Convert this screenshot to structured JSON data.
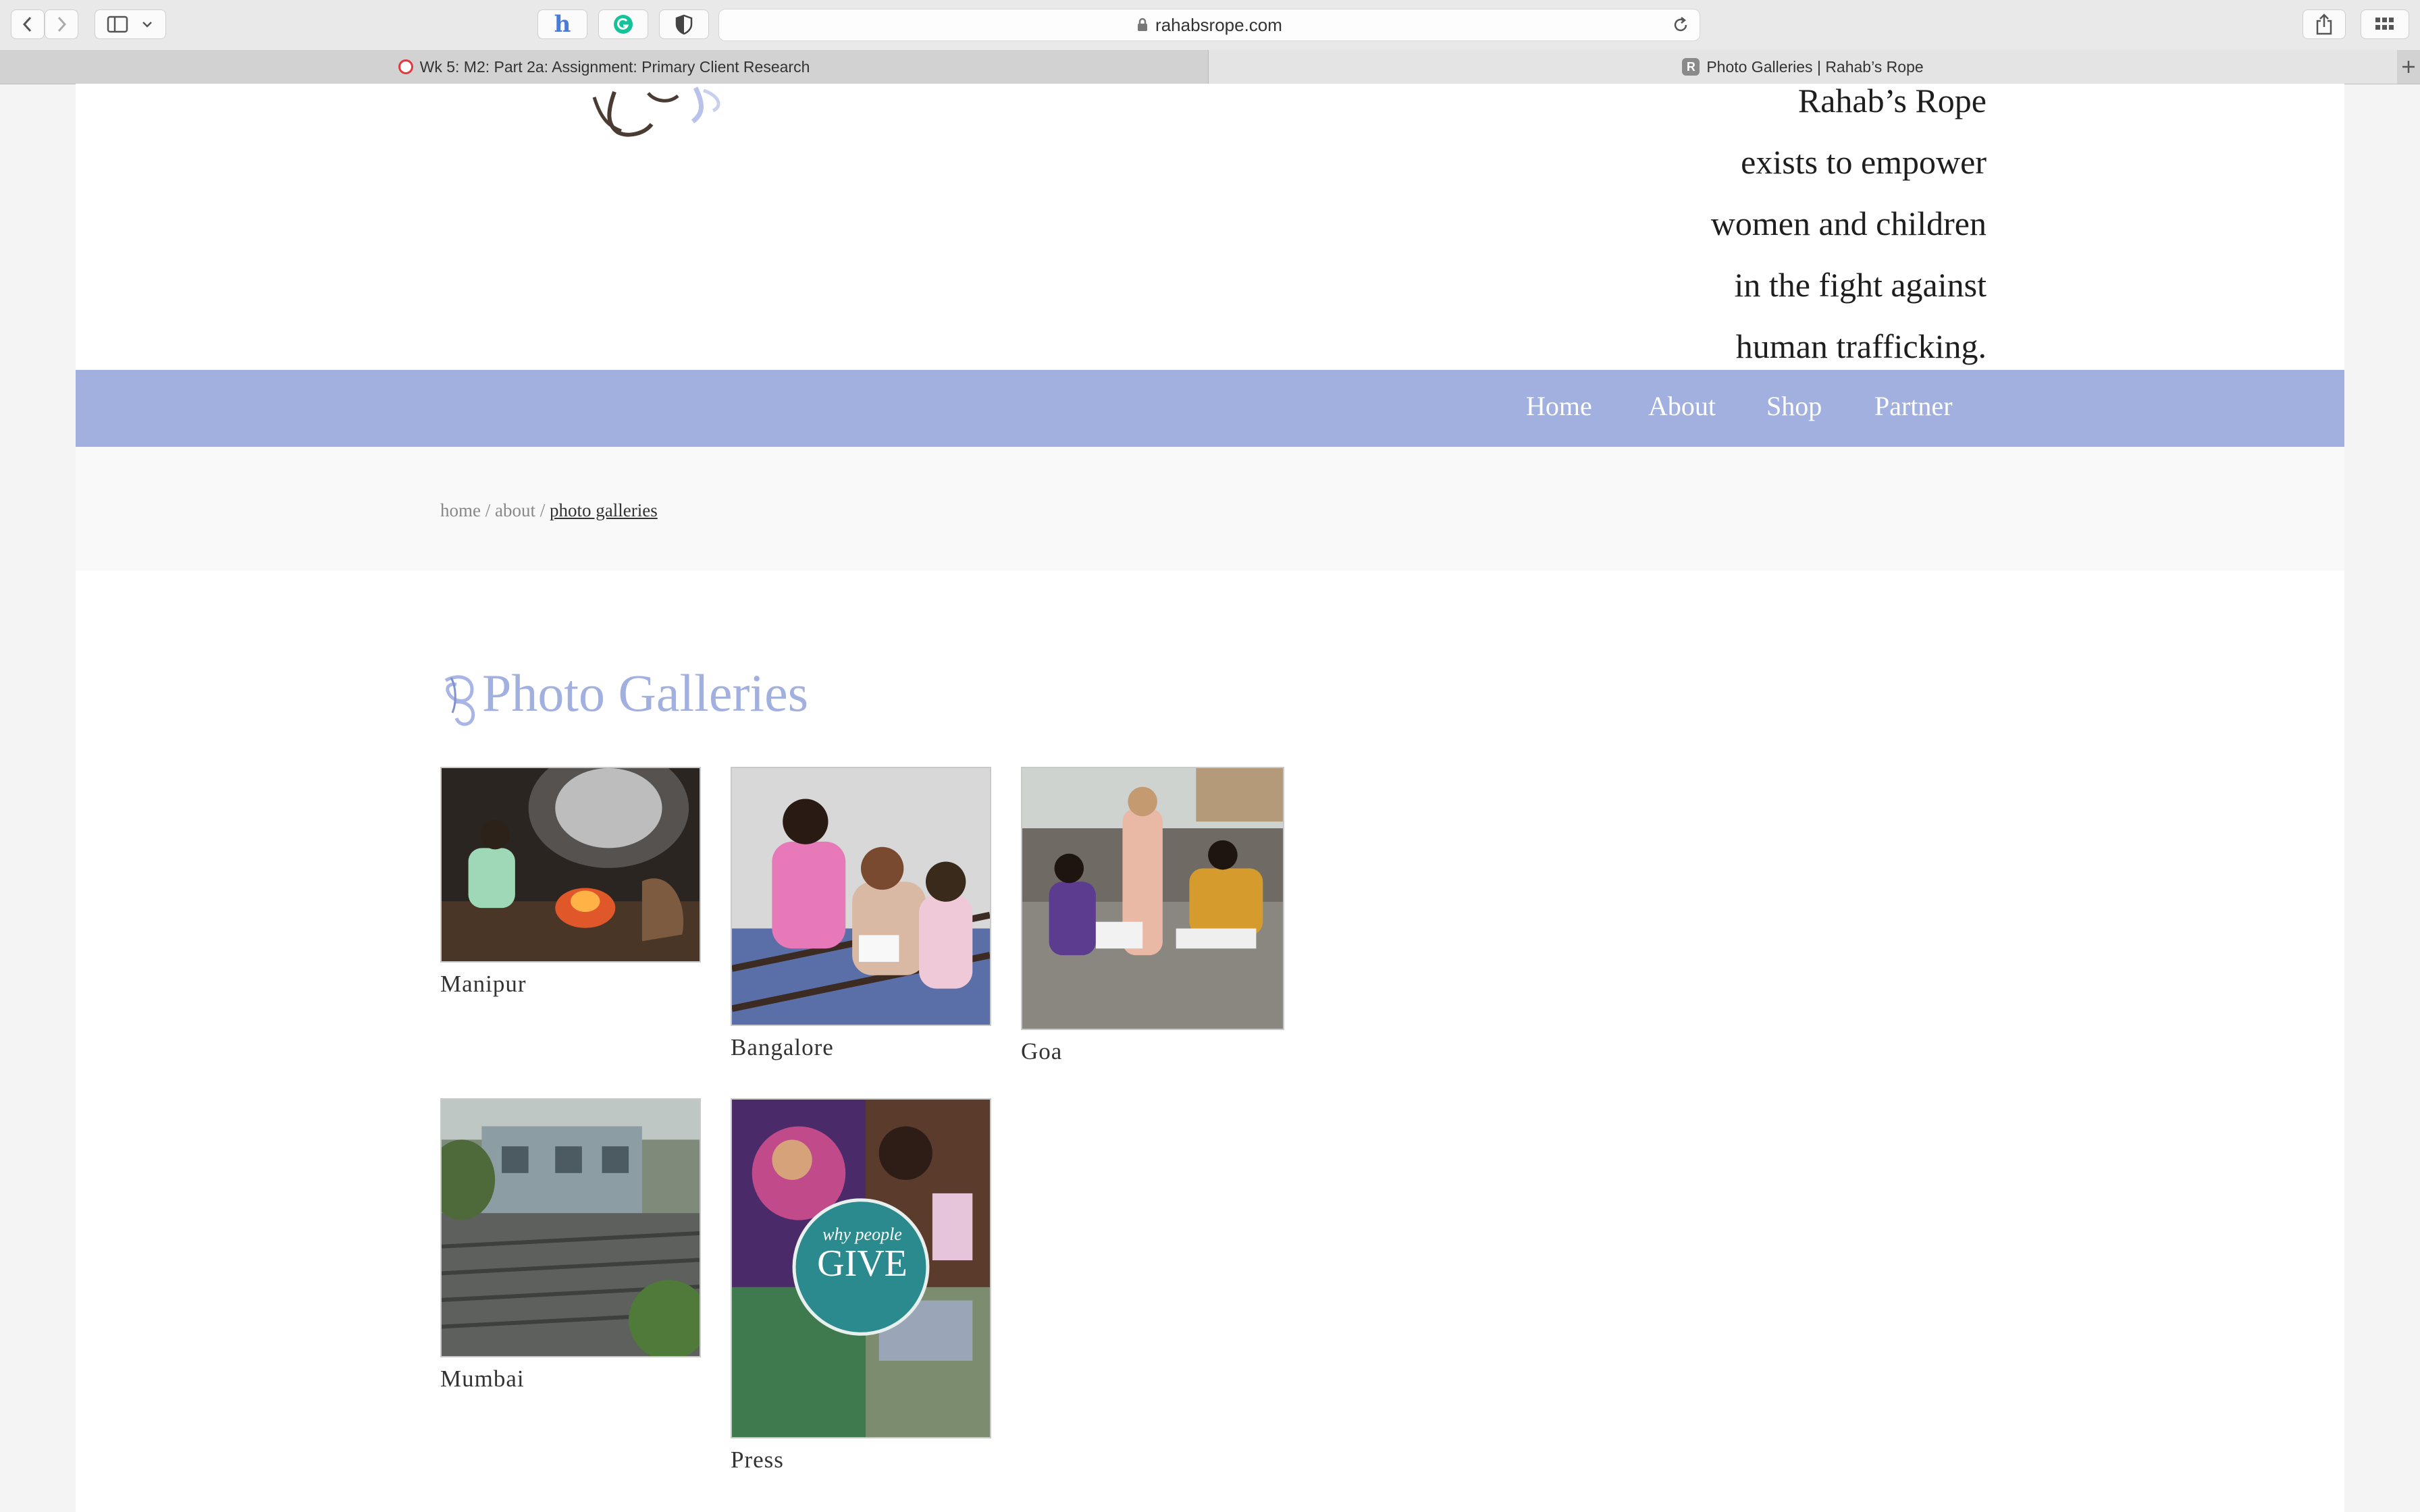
{
  "browser": {
    "url": "rahabsrope.com",
    "tabs": [
      {
        "title": "Wk 5: M2: Part 2a: Assignment: Primary Client Research",
        "active": false
      },
      {
        "title": "Photo Galleries | Rahab’s Rope",
        "active": true
      }
    ]
  },
  "header": {
    "tagline_lines": [
      "Rahab’s Rope",
      "exists to empower",
      "women and children",
      "in the fight against",
      "human trafficking."
    ]
  },
  "nav": {
    "items": [
      {
        "label": "Home"
      },
      {
        "label": "About"
      },
      {
        "label": "Shop"
      },
      {
        "label": "Partner"
      }
    ],
    "bg_color": "#a2b0e0"
  },
  "breadcrumb": {
    "home": "home",
    "sep": "/",
    "about": "about",
    "current": "photo galleries"
  },
  "page": {
    "title": "Photo Galleries",
    "title_color": "#a2b0e0"
  },
  "galleries": [
    {
      "label": "Manipur"
    },
    {
      "label": "Bangalore"
    },
    {
      "label": "Goa"
    },
    {
      "label": "Mumbai"
    },
    {
      "label": "Press",
      "cover_text_small": "why people",
      "cover_text_large": "GIVE"
    }
  ]
}
